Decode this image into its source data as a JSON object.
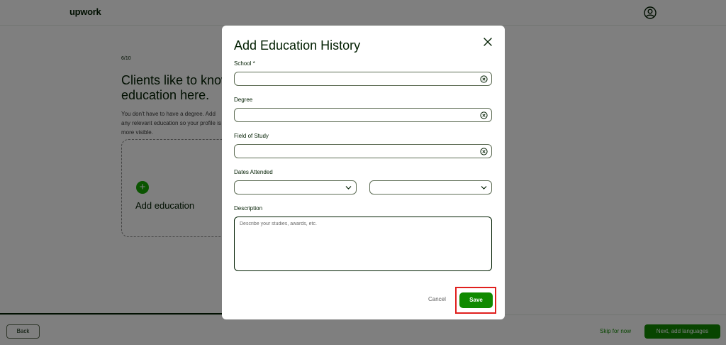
{
  "header": {
    "logo": "upwork",
    "account_icon": "user-circle-icon"
  },
  "background": {
    "step": "6/10",
    "title_line1": "Clients like to know",
    "title_line2": "education here.",
    "subtitle": "You don't have to have a degree. Add any relevant education so your profile is more visible.",
    "add_education_label": "Add education",
    "add_icon": "plus-icon"
  },
  "footer": {
    "back_label": "Back",
    "skip_label": "Skip for now",
    "next_label": "Next, add languages"
  },
  "modal": {
    "title": "Add Education History",
    "close_icon": "close-icon",
    "fields": {
      "school": {
        "label": "School *",
        "value": ""
      },
      "degree": {
        "label": "Degree",
        "value": ""
      },
      "field_of_study": {
        "label": "Field of Study",
        "value": ""
      },
      "dates_attended": {
        "label": "Dates Attended",
        "from_value": "",
        "to_value": ""
      },
      "description": {
        "label": "Description",
        "placeholder": "Describe your studies, awards, etc.",
        "value": ""
      }
    },
    "cancel_label": "Cancel",
    "save_label": "Save"
  },
  "colors": {
    "brand_green": "#108a00",
    "accent_green": "#14a800",
    "highlight_red": "#e0201e",
    "text_dark": "#001e00"
  }
}
